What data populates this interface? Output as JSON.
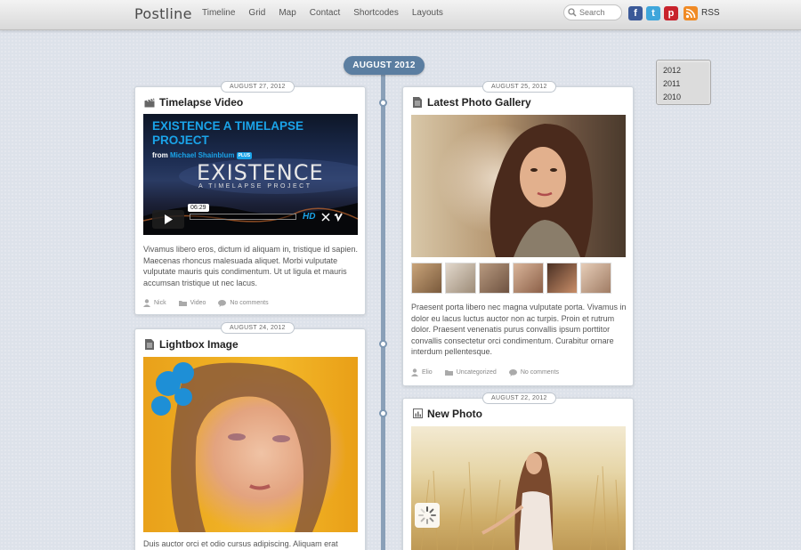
{
  "site": {
    "logo": "Postline"
  },
  "nav": [
    "Timeline",
    "Grid",
    "Map",
    "Contact",
    "Shortcodes",
    "Layouts"
  ],
  "search": {
    "placeholder": "Search"
  },
  "social": {
    "icons": [
      "facebook-icon",
      "twitter-icon",
      "pinterest-icon",
      "rss-icon"
    ],
    "rss_label": "RSS"
  },
  "timeline": {
    "month": "AUGUST 2012"
  },
  "years": [
    "2012",
    "2011",
    "2010"
  ],
  "posts": {
    "video": {
      "date": "AUGUST 27, 2012",
      "title": "Timelapse Video",
      "icon": "clapperboard-icon",
      "video_title": "EXISTENCE A TIMELAPSE PROJECT",
      "video_from": "from",
      "video_author": "Michael Shainblum",
      "video_badge": "PLUS",
      "video_big": "EXISTENCE",
      "video_sub": "A TIMELAPSE PROJECT",
      "video_time": "06:29",
      "video_hd": "HD",
      "excerpt": "Vivamus libero eros, dictum id aliquam in, tristique id sapien. Maecenas rhoncus malesuada aliquet. Morbi vulputate vulputate mauris quis condimentum. Ut ut ligula et mauris accumsan tristique ut nec lacus.",
      "author": "Nick",
      "category": "Video",
      "comments": "No comments"
    },
    "gallery": {
      "date": "AUGUST 25, 2012",
      "title": "Latest Photo Gallery",
      "icon": "document-icon",
      "excerpt": "Praesent porta libero nec magna vulputate porta. Vivamus in dolor eu lacus luctus auctor non ac turpis. Proin et rutrum dolor. Praesent venenatis purus convallis ipsum porttitor convallis consectetur orci condimentum. Curabitur ornare interdum pellentesque.",
      "author": "Elio",
      "category": "Uncategorized",
      "comments": "No comments"
    },
    "lightbox": {
      "date": "AUGUST 24, 2012",
      "title": "Lightbox Image",
      "icon": "document-icon",
      "excerpt": "Duis auctor orci et odio cursus adipiscing. Aliquam erat"
    },
    "photo": {
      "date": "AUGUST 22, 2012",
      "title": "New Photo",
      "icon": "chart-icon"
    }
  },
  "colors": {
    "accent": "#5b7ea1",
    "timeline": "#8aa0b8",
    "video_blue": "#1aa3e8"
  }
}
